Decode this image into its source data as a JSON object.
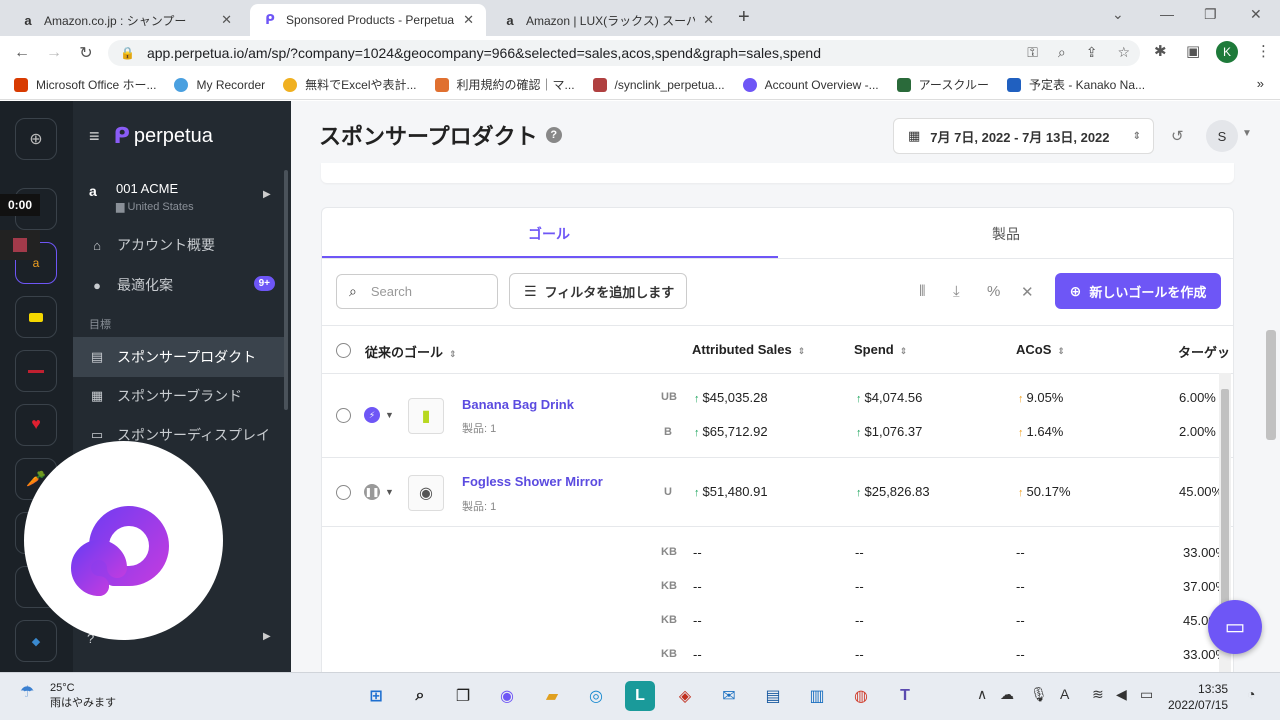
{
  "browser": {
    "tabs": [
      {
        "title": "Amazon.co.jp : シャンプー",
        "icon": "amazon-icon"
      },
      {
        "title": "Sponsored Products - Perpetua",
        "icon": "perpetua-icon"
      },
      {
        "title": "Amazon | LUX(ラックス) スーパーリッチ",
        "icon": "amazon-icon"
      }
    ],
    "url": "app.perpetua.io/am/sp/?company=1024&geocompany=966&selected=sales,acos,spend&graph=sales,spend",
    "profile_initial": "K",
    "bookmarks": [
      {
        "label": "Microsoft Office ホー...",
        "color": "#d83b01"
      },
      {
        "label": "My Recorder",
        "color": "#4aa0e0"
      },
      {
        "label": "無料でExcelや表計...",
        "color": "#f0b020"
      },
      {
        "label": "利用規約の確認｜マ...",
        "color": "#e07030"
      },
      {
        "label": "/synclink_perpetua...",
        "color": "#b04040"
      },
      {
        "label": "Account Overview -...",
        "color": "#6e56f6"
      },
      {
        "label": "アースクルー",
        "color": "#2a6a3a"
      },
      {
        "label": "予定表 - Kanako Na...",
        "color": "#2060c0"
      }
    ]
  },
  "sidebar": {
    "brand": "perpetua",
    "account_name": "001 ACME",
    "account_country": "United States",
    "items": [
      {
        "label": "アカウント概要",
        "icon": "home-icon"
      },
      {
        "label": "最適化案",
        "icon": "lightbulb-icon",
        "badge": "9+"
      }
    ],
    "section_label": "目標",
    "goals": [
      {
        "label": "スポンサープロダクト",
        "icon": "box-icon",
        "active": true
      },
      {
        "label": "スポンサーブランド",
        "icon": "grid-icon"
      },
      {
        "label": "スポンサーディスプレイ",
        "icon": "display-icon"
      }
    ]
  },
  "header": {
    "title": "スポンサープロダクト",
    "date_range": "7月 7日, 2022 - 7月 13日, 2022",
    "user_initial": "S"
  },
  "tabs": [
    "ゴール",
    "製品"
  ],
  "toolbar": {
    "search_placeholder": "Search",
    "filter_label": "フィルタを追加します",
    "new_goal_label": "新しいゴールを作成"
  },
  "table": {
    "columns": [
      "従来のゴール",
      "Attributed Sales",
      "Spend",
      "ACoS",
      "ターゲット"
    ],
    "rows": [
      {
        "name": "Banana Bag Drink",
        "sub": "製品: 1",
        "status": "active",
        "lines": [
          {
            "tag": "UB",
            "sales": "$45,035.28",
            "spend": "$4,074.56",
            "acos": "9.05%",
            "target": "6.00%"
          },
          {
            "tag": "B",
            "sales": "$65,712.92",
            "spend": "$1,076.37",
            "acos": "1.64%",
            "target": "2.00%"
          }
        ]
      },
      {
        "name": "Fogless Shower Mirror",
        "sub": "製品: 1",
        "status": "paused",
        "lines": [
          {
            "tag": "U",
            "sales": "$51,480.91",
            "spend": "$25,826.83",
            "acos": "50.17%",
            "target": "45.00%"
          }
        ]
      }
    ],
    "extra_rows": [
      {
        "tag": "KB",
        "sales": "--",
        "spend": "--",
        "acos": "--",
        "target": "33.00%"
      },
      {
        "tag": "KB",
        "sales": "--",
        "spend": "--",
        "acos": "--",
        "target": "37.00%"
      },
      {
        "tag": "KB",
        "sales": "--",
        "spend": "--",
        "acos": "--",
        "target": "45.00%"
      },
      {
        "tag": "KB",
        "sales": "--",
        "spend": "--",
        "acos": "--",
        "target": "33.00%"
      }
    ]
  },
  "recorder": {
    "timer": "0:00"
  },
  "taskbar": {
    "temperature": "25°C",
    "weather": "雨はやみます",
    "time": "13:35",
    "date": "2022/07/15"
  }
}
